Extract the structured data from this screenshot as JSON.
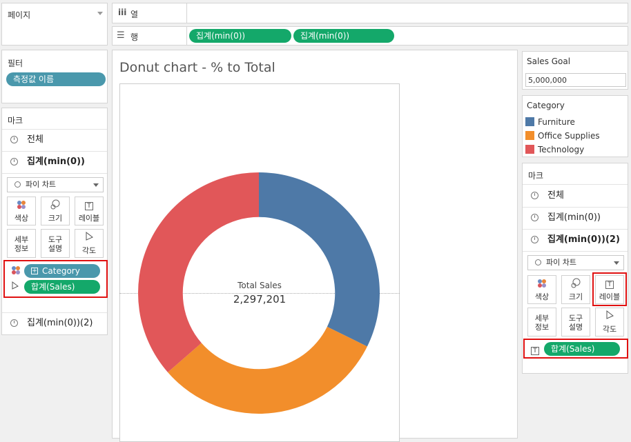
{
  "pages_card": {
    "title": "페이지"
  },
  "shelves": {
    "columns": {
      "icon": "columns-icon",
      "label": "열"
    },
    "rows": {
      "icon": "rows-icon",
      "label": "행",
      "pills": [
        "집계(min(0))",
        "집계(min(0))"
      ]
    }
  },
  "filters": {
    "title": "필터",
    "pill": "측정값 이름"
  },
  "marks_left": {
    "title": "마크",
    "all": "전체",
    "layer1": "집계(min(0))",
    "mark_type": "파이 차트",
    "buttons": {
      "color": "색상",
      "size": "크기",
      "label": "레이블",
      "detail_1": "세부",
      "detail_2": "정보",
      "tooltip_1": "도구",
      "tooltip_2": "설명",
      "angle": "각도"
    },
    "pill_category": "Category",
    "pill_sales": "합계(Sales)",
    "layer2": "집계(min(0))(2)"
  },
  "sheet": {
    "title": "Donut chart - % to Total",
    "center_label": "Total Sales",
    "center_value": "2,297,201"
  },
  "chart_data": {
    "type": "pie",
    "categories": [
      "Furniture",
      "Office Supplies",
      "Technology"
    ],
    "values": [
      742000,
      719047,
      836154
    ],
    "colors": [
      "#4e79a7",
      "#f28e2b",
      "#e15759"
    ],
    "inner_radius_ratio": 0.63
  },
  "sales_goal": {
    "title": "Sales Goal",
    "value": "5,000,000"
  },
  "legend": {
    "title": "Category",
    "items": [
      {
        "label": "Furniture",
        "color": "#4e79a7"
      },
      {
        "label": "Office Supplies",
        "color": "#f28e2b"
      },
      {
        "label": "Technology",
        "color": "#e15759"
      }
    ]
  },
  "marks_right": {
    "title": "마크",
    "all": "전체",
    "layer1": "집계(min(0))",
    "layer2": "집계(min(0))(2)",
    "mark_type": "파이 차트",
    "buttons": {
      "color": "색상",
      "size": "크기",
      "label": "레이블",
      "detail_1": "세부",
      "detail_2": "정보",
      "tooltip_1": "도구",
      "tooltip_2": "설명",
      "angle": "각도"
    },
    "pill_sales": "합계(Sales)"
  }
}
